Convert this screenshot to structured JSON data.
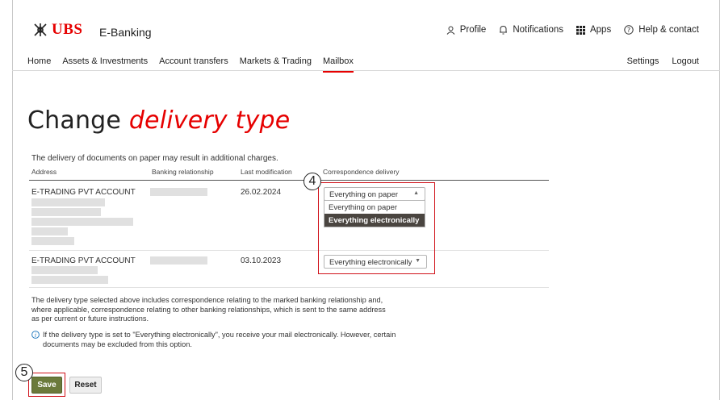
{
  "brand": {
    "logo_text": "UBS",
    "app_name": "E-Banking",
    "accent_color": "#e60000"
  },
  "top_actions": [
    {
      "label": "Profile",
      "icon": "person-icon"
    },
    {
      "label": "Notifications",
      "icon": "bell-icon"
    },
    {
      "label": "Apps",
      "icon": "grid-icon"
    },
    {
      "label": "Help & contact",
      "icon": "help-icon"
    }
  ],
  "nav": {
    "items": [
      "Home",
      "Assets & Investments",
      "Account transfers",
      "Markets & Trading",
      "Mailbox"
    ],
    "active": "Mailbox",
    "right": [
      "Settings",
      "Logout"
    ]
  },
  "page": {
    "title_plain": "Change",
    "title_emphasis": "delivery type",
    "charges_note": "The delivery of documents on paper may result in additional charges."
  },
  "table": {
    "headers": [
      "Address",
      "Banking relationship",
      "Last modification",
      "Correspondence delivery"
    ],
    "rows": [
      {
        "address": "E-TRADING PVT ACCOUNT",
        "last_modification": "26.02.2024",
        "delivery": "Everything on paper"
      },
      {
        "address": "E-TRADING PVT ACCOUNT",
        "last_modification": "03.10.2023",
        "delivery": "Everything electronically"
      }
    ]
  },
  "dropdown": {
    "options": [
      "Everything on paper",
      "Everything electronically"
    ],
    "highlighted": "Everything electronically"
  },
  "notes": {
    "scope_text": "The delivery type selected above includes correspondence relating to the marked banking relationship and, where applicable, correspondence relating to other banking relationships, which is sent to the same address as per current or future instructions.",
    "info_text": "If the delivery type is set to \"Everything electronically\", you receive your mail electronically. However, certain documents may be excluded from this option."
  },
  "buttons": {
    "save": "Save",
    "reset": "Reset"
  },
  "markers": {
    "step_4": "4",
    "step_5": "5"
  }
}
